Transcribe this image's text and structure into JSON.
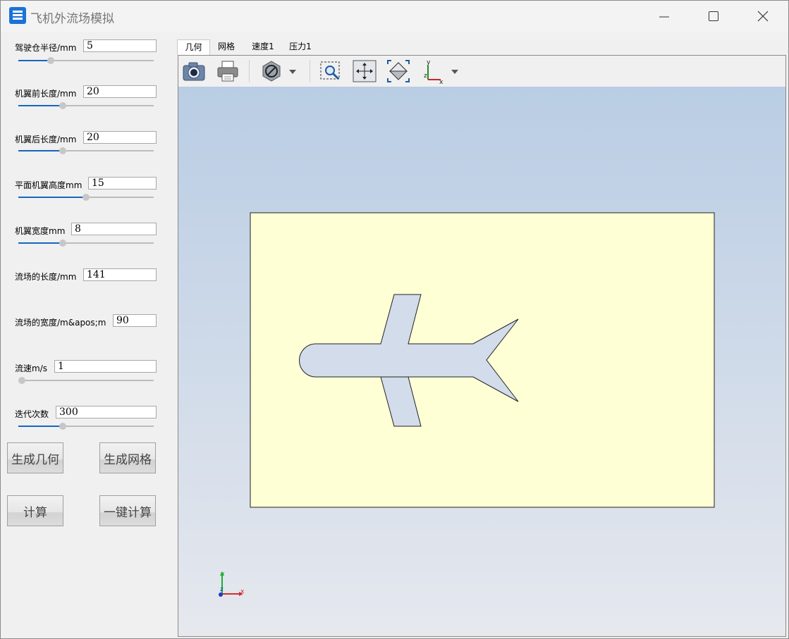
{
  "window": {
    "title": "飞机外流场模拟"
  },
  "params": [
    {
      "label": "驾驶仓半径/mm",
      "value": "5",
      "slider": 0.24
    },
    {
      "label": "机翼前长度/mm",
      "value": "20",
      "slider": 0.33
    },
    {
      "label": "机翼后长度/mm",
      "value": "20",
      "slider": 0.33
    },
    {
      "label": "平面机翼高度mm",
      "value": "15",
      "slider": 0.5
    },
    {
      "label": "机翼宽度mm",
      "value": "8",
      "slider": 0.33
    },
    {
      "label": "流场的长度/mm",
      "value": "141"
    },
    {
      "label": "流场的宽度/m&apos;m",
      "value": "90"
    },
    {
      "label": "流速m/s",
      "value": "1",
      "slider": 0.0
    },
    {
      "label": "迭代次数",
      "value": "300",
      "slider": 0.33
    }
  ],
  "buttons": {
    "gen_geometry": "生成几何",
    "gen_mesh": "生成网格",
    "compute": "计算",
    "one_click": "一键计算"
  },
  "tabs": [
    "几何",
    "网格",
    "速度1",
    "压力1"
  ],
  "toolbar": [
    "camera-icon",
    "print-icon",
    "display-mode-icon",
    "zoom-box-icon",
    "pan-icon",
    "fit-view-icon",
    "axes-icon"
  ],
  "axes": {
    "x": "x",
    "y": "y",
    "z": "z"
  },
  "colors": {
    "domain": "#ffffd6",
    "airplane": "#d2dcea",
    "accent": "#1565c0"
  }
}
